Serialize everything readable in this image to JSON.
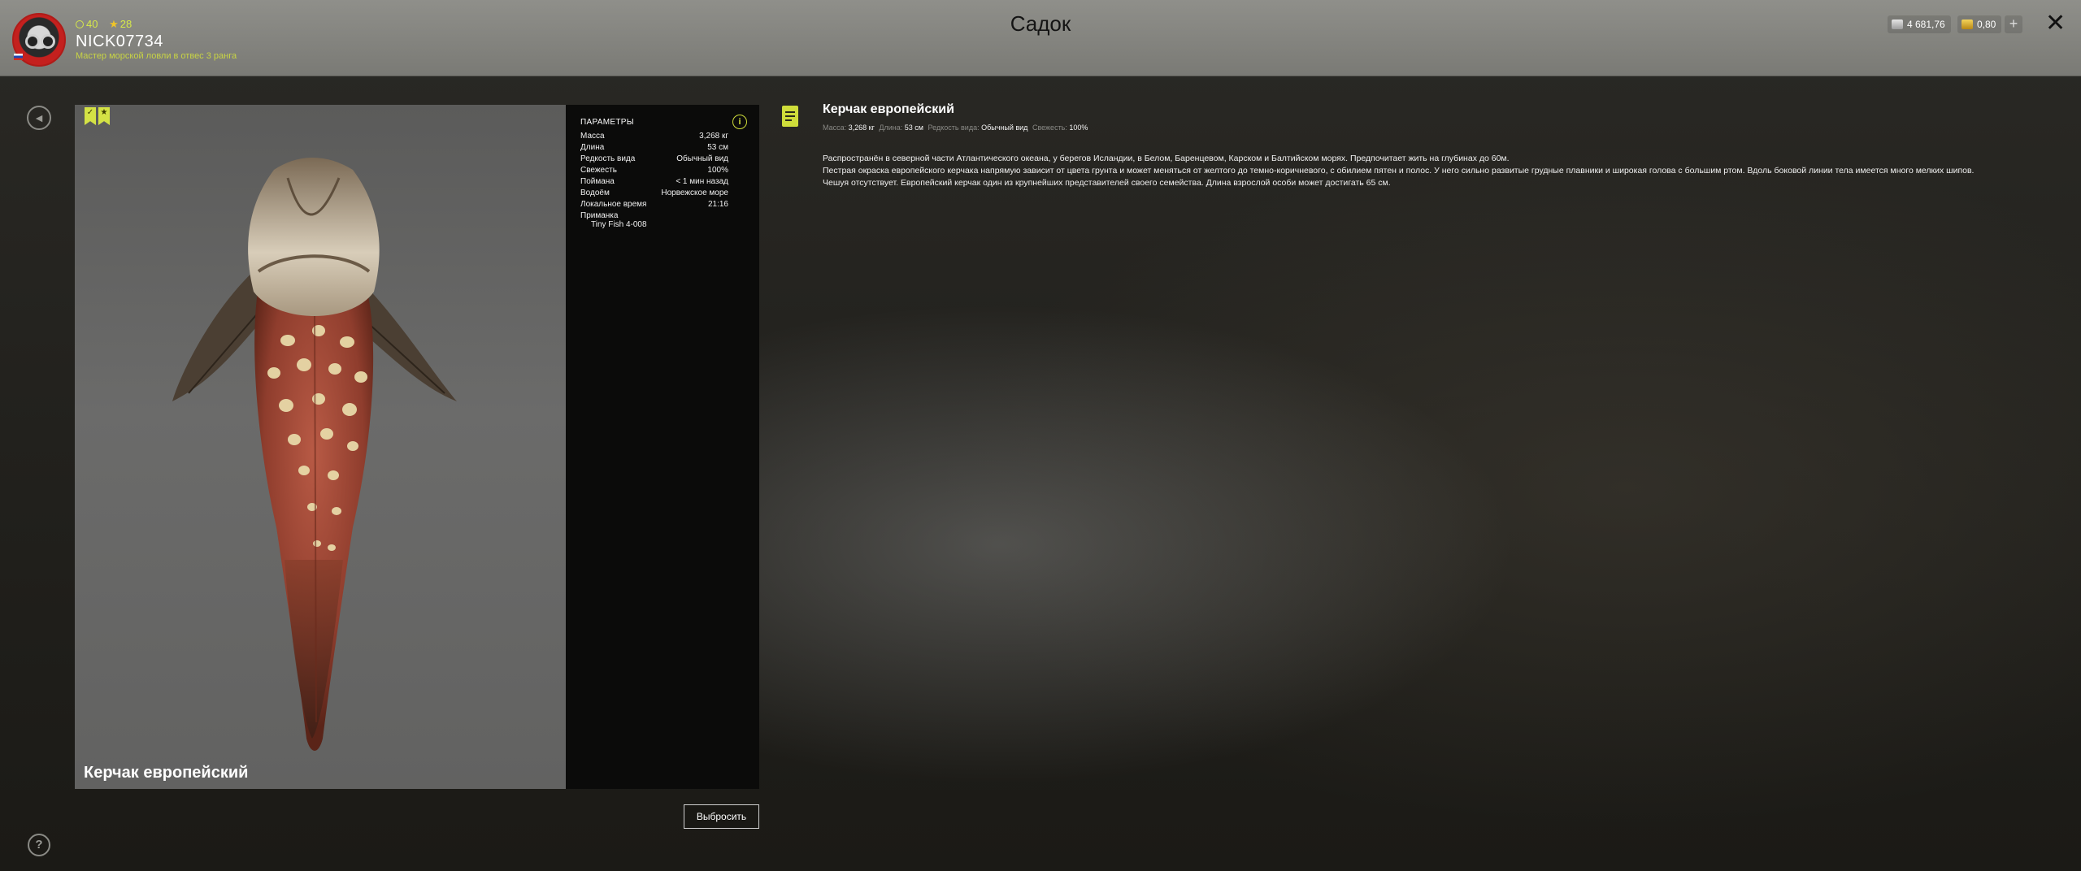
{
  "header": {
    "title": "Садок",
    "player": {
      "username": "NICK07734",
      "rank_text": "Мастер морской ловли в отвес 3 ранга",
      "level": "40",
      "stars": "28"
    },
    "currencies": [
      {
        "name": "silver-coins",
        "value": "4 681,76",
        "color": "#c8c8c8"
      },
      {
        "name": "gold-coins",
        "value": "0,80",
        "color": "#e0b030"
      }
    ],
    "add_label": "+",
    "close_label": "✕"
  },
  "fish": {
    "name": "Керчак европейский",
    "params_title": "ПАРАМЕТРЫ",
    "params": [
      {
        "key": "Масса",
        "value": "3,268 кг"
      },
      {
        "key": "Длина",
        "value": "53 см"
      },
      {
        "key": "Редкость вида",
        "value": "Обычный вид"
      },
      {
        "key": "Свежесть",
        "value": "100%"
      },
      {
        "key": "Поймана",
        "value": "< 1 мин назад"
      },
      {
        "key": "Водоём",
        "value": "Норвежское море"
      },
      {
        "key": "Локальное время",
        "value": "21:16"
      }
    ],
    "bait_label": "Приманка",
    "bait_value": "Tiny Fish 4-008",
    "discard_label": "Выбросить"
  },
  "description": {
    "title": "Керчак европейский",
    "summary": {
      "mass_label": "Масса:",
      "mass_value": "3,268 кг",
      "length_label": "Длина:",
      "length_value": "53 см",
      "rarity_label": "Редкость вида:",
      "rarity_value": "Обычный вид",
      "fresh_label": "Свежесть:",
      "fresh_value": "100%"
    },
    "paragraphs": [
      "Распространён в северной части Атлантического океана, у берегов Исландии, в Белом, Баренцевом, Карском и Балтийском морях. Предпочитает жить на глубинах до 60м.",
      "Пестрая окраска европейского керчака напрямую зависит от цвета грунта и может меняться от желтого до темно-коричневого, с обилием пятен и полос. У него сильно развитые грудные плавники и широкая голова с большим ртом. Вдоль боковой линии тела имеется много мелких шипов.",
      "Чешуя отсутствует. Европейский керчак один из крупнейших представителей своего семейства. Длина взрослой особи может достигать 65 см."
    ]
  },
  "icons": {
    "back": "back-icon",
    "help": "help-icon",
    "info": "info-icon",
    "document": "document-icon"
  },
  "colors": {
    "accent": "#cfdd3a",
    "header_bg": "#858580"
  }
}
